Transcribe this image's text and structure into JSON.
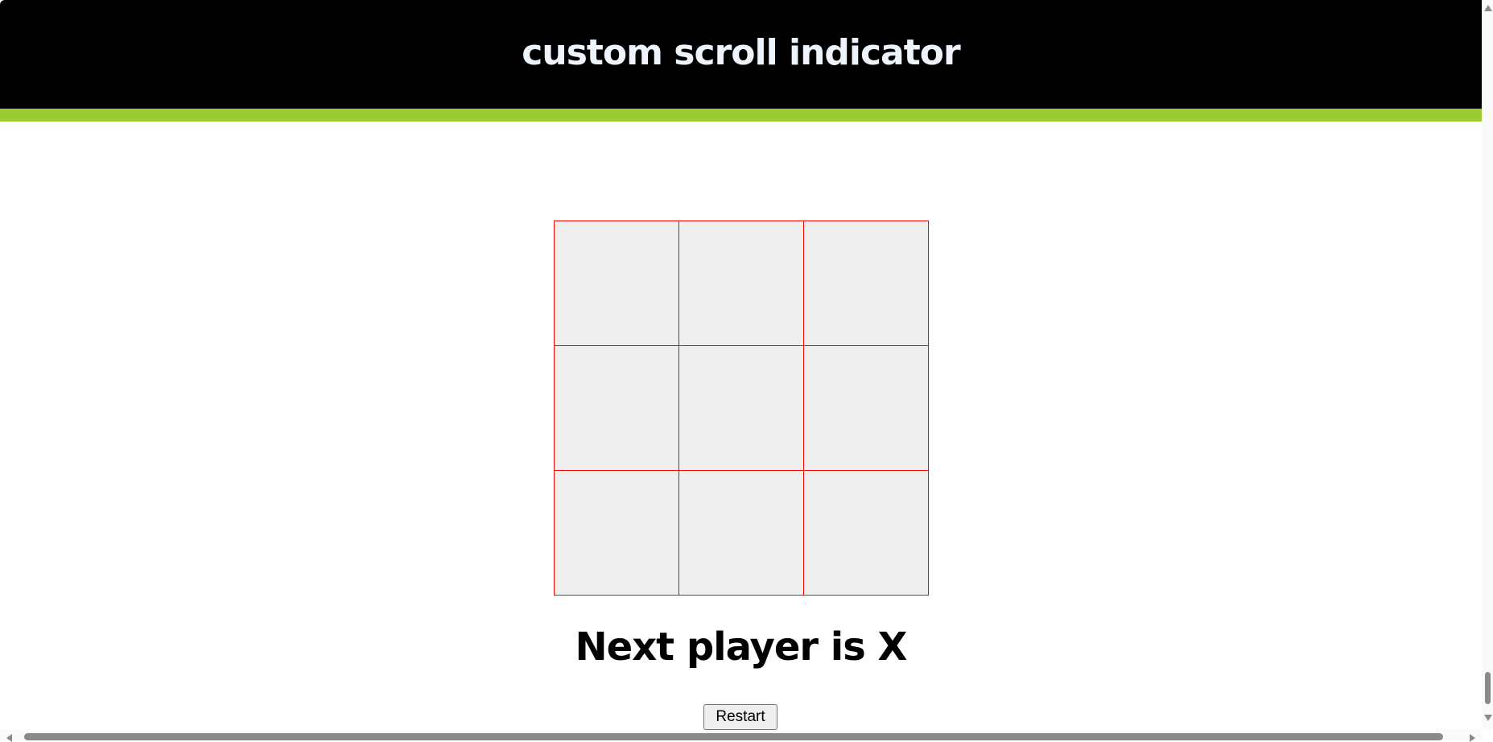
{
  "header": {
    "title": "custom scroll indicator"
  },
  "scroll_indicator": {
    "progress_percent": 100,
    "color": "#9acd32"
  },
  "board": {
    "cells": [
      "",
      "",
      "",
      "",
      "",
      "",
      "",
      "",
      ""
    ],
    "cell_border_color": "#ff0000",
    "cell_background": "#efefef"
  },
  "status": {
    "text": "Next player is X"
  },
  "controls": {
    "restart_label": "Restart"
  }
}
